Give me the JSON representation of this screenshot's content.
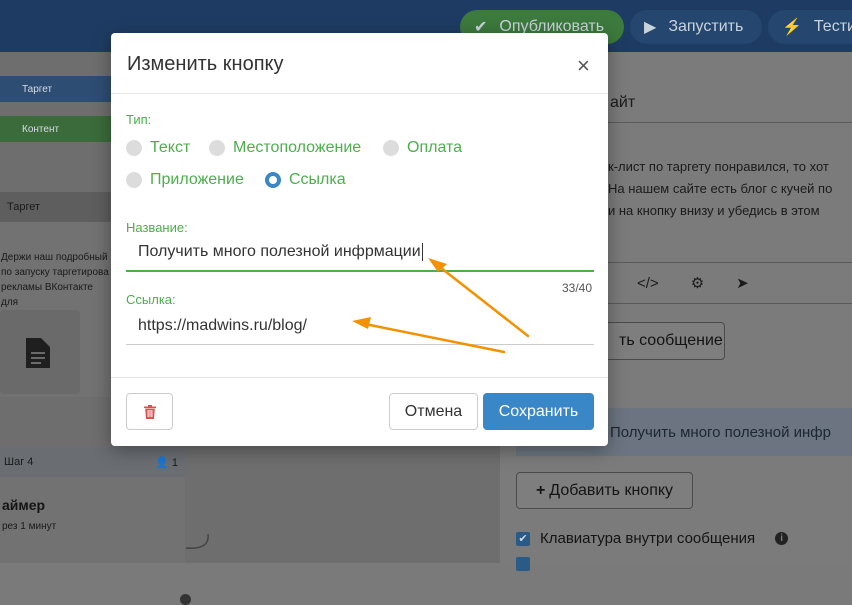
{
  "topbar": {
    "publish_label": "Опубликовать",
    "run_label": "Запустить",
    "test_label": "Тестир"
  },
  "canvas": {
    "node_target_label": "Таргет",
    "node_content_label": "Контент",
    "step_title": "Таргет",
    "step_text_lines": [
      "Держи наш подробный",
      "по запуску таргетирова",
      "рекламы ВКонтакте для"
    ],
    "step4_label": "Шаг 4",
    "step4_count": "1",
    "timer_title": "аймер",
    "timer_sub": "рез 1 минут"
  },
  "right_panel": {
    "heading_fragment": "айт",
    "message_lines": [
      "к-лист по таргету понравился, то хот",
      "На нашем сайте есть блог с кучей по",
      "и на кнопку внизу и убедись в этом"
    ],
    "add_message_label": "ть сообщение",
    "existing_button_label": "Получить много полезной инфр",
    "add_button_label": "Добавить кнопку",
    "keyboard_label": "Клавиатура внутри сообщения"
  },
  "modal": {
    "title": "Изменить кнопку",
    "close_glyph": "×",
    "type_label": "Тип:",
    "types": [
      {
        "label": "Текст",
        "selected": false
      },
      {
        "label": "Местоположение",
        "selected": false
      },
      {
        "label": "Оплата",
        "selected": false
      },
      {
        "label": "Приложение",
        "selected": false
      },
      {
        "label": "Ссылка",
        "selected": true
      }
    ],
    "name_label": "Название:",
    "name_value": "Получить много полезной инфрмации",
    "name_counter": "33/40",
    "link_label": "Ссылка:",
    "link_value": "https://madwins.ru/blog/",
    "cancel_label": "Отмена",
    "save_label": "Сохранить"
  },
  "colors": {
    "accent_green": "#4cae4c",
    "primary_blue": "#3a87c8",
    "annotation_arrow": "#f39200",
    "delete_red": "#d9534f"
  }
}
